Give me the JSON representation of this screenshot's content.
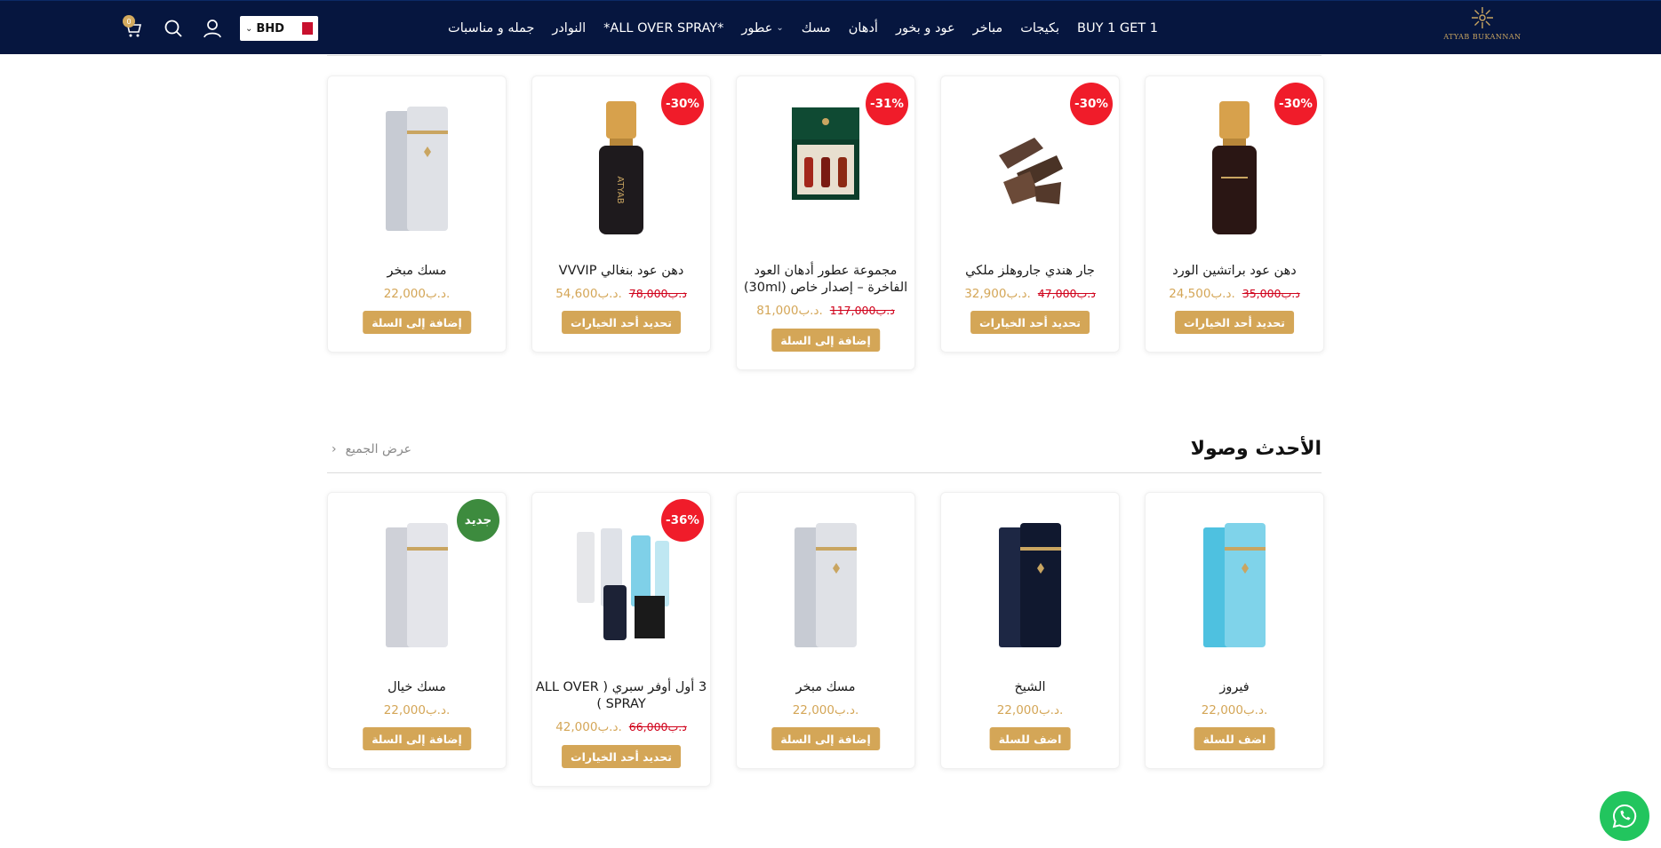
{
  "header": {
    "logo_text": "ATYAB BUKANNAN",
    "nav": [
      "BUY 1 GET 1",
      "بكيجات",
      "مباخر",
      "عود و بخور",
      "أدهان",
      "مسك",
      "عطور",
      "*ALL OVER SPRAY*",
      "النوادر",
      "جمله و مناسبات"
    ],
    "currency": "BHD",
    "cart_count": "0",
    "icons": [
      "cart-icon",
      "search-icon",
      "user-icon",
      "chevron-down-icon"
    ]
  },
  "top_products": [
    {
      "name": "مسك مبخر",
      "price": "22,000د.ب.",
      "old_price": "",
      "badge": "",
      "button": "إضافة إلى السلة"
    },
    {
      "name": "دهن عود بنغالي VVVIP",
      "price": "54,600د.ب.",
      "old_price": "78,000د.ب",
      "badge": "-30%",
      "button": "تحديد أحد الخيارات"
    },
    {
      "name": "مجموعة عطور أدهان العود الفاخرة – إصدار خاص (30ml)",
      "price": "81,000د.ب.",
      "old_price": "117,000د.ب",
      "badge": "-31%",
      "button": "إضافة إلى السلة"
    },
    {
      "name": "جار هندي جاروهلز ملكي",
      "price": "32,900د.ب.",
      "old_price": "47,000د.ب",
      "badge": "-30%",
      "button": "تحديد أحد الخيارات"
    },
    {
      "name": "دهن عود براتشين الورد",
      "price": "24,500د.ب.",
      "old_price": "35,000د.ب",
      "badge": "-30%",
      "button": "تحديد أحد الخيارات"
    }
  ],
  "section": {
    "title": "الأحدث وصولا",
    "view_all": "عرض الجميع"
  },
  "new_products": [
    {
      "name": "مسك خيال",
      "price": "22,000د.ب.",
      "old_price": "",
      "badge": "جديد",
      "button": "إضافة إلى السلة"
    },
    {
      "name": "3 أول أوفر سبري ( ALL OVER SPRAY )",
      "price": "42,000د.ب.",
      "old_price": "66,000د.ب",
      "badge": "-36%",
      "button": "تحديد أحد الخيارات"
    },
    {
      "name": "مسك مبخر",
      "price": "22,000د.ب.",
      "old_price": "",
      "badge": "",
      "button": "إضافة إلى السلة"
    },
    {
      "name": "الشيخ",
      "price": "22,000د.ب.",
      "old_price": "",
      "badge": "",
      "button": "اضف للسلة"
    },
    {
      "name": "فيروز",
      "price": "22,000د.ب.",
      "old_price": "",
      "badge": "",
      "button": "اضف للسلة"
    }
  ],
  "colors": {
    "header_bg": "#06163f",
    "gold": "#d4a657",
    "sale_red": "#f01c2a",
    "new_green": "#3d8b3e",
    "whatsapp": "#22c55e"
  }
}
